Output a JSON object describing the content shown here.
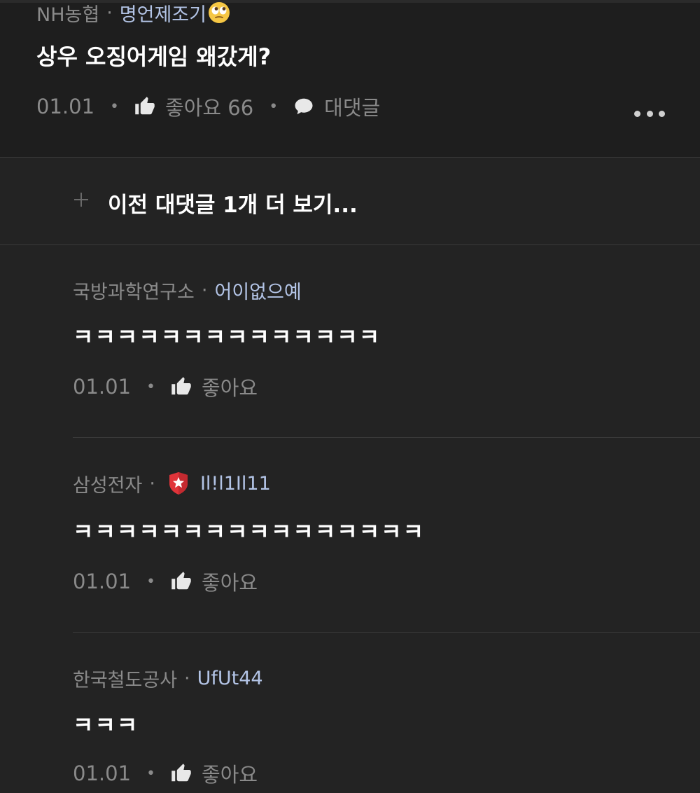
{
  "main_comment": {
    "company": "NH농협",
    "separator": "·",
    "nickname": "명언제조기",
    "emoji": "rolling-eyes-emoji",
    "text": "상우 오징어게임 왜갔게?",
    "date": "01.01",
    "like_label": "좋아요 66",
    "reply_label": "대댓글"
  },
  "prev_replies": {
    "label": "이전 대댓글 1개 더 보기..."
  },
  "replies": [
    {
      "company": "국방과학연구소",
      "nickname": "어이없으예",
      "text": "ㅋㅋㅋㅋㅋㅋㅋㅋㅋㅋㅋㅋㅋㅋ",
      "date": "01.01",
      "like_label": "좋아요"
    },
    {
      "company": "삼성전자",
      "badge": "shield-star-badge",
      "nickname": "Il!l1Il11",
      "text": "ㅋㅋㅋㅋㅋㅋㅋㅋㅋㅋㅋㅋㅋㅋㅋㅋ",
      "date": "01.01",
      "like_label": "좋아요"
    },
    {
      "company": "한국철도공사",
      "nickname": "UfUt44",
      "text": "ㅋㅋㅋ",
      "date": "01.01",
      "like_label": "좋아요"
    }
  ],
  "colors": {
    "background": "#232323",
    "main_background": "#1e1e1e",
    "meta_gray": "#8a8a8a",
    "nickname_blue": "#b3c4e6",
    "badge_red": "#e0343a"
  }
}
